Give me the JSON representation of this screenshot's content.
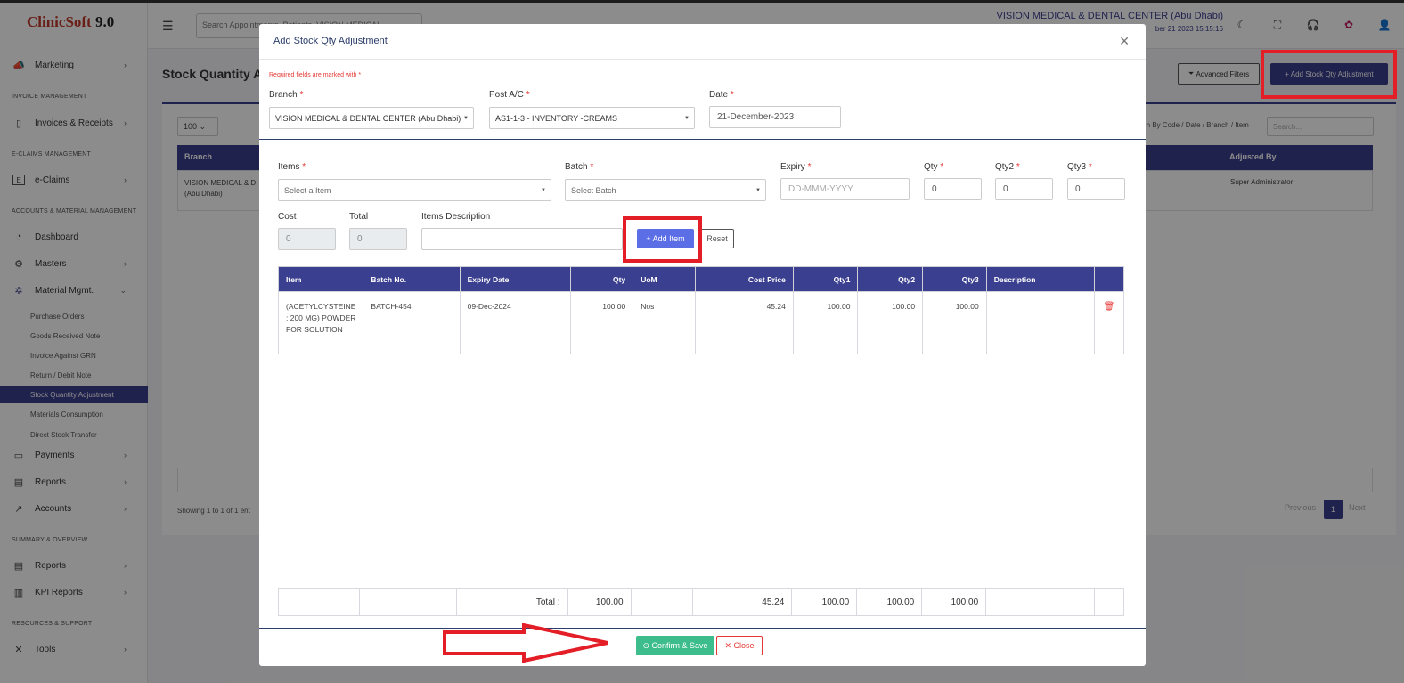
{
  "app": {
    "logo_main": "ClinicSoft",
    "logo_version": " 9.0"
  },
  "topbar": {
    "search_placeholder": "Search Appointments, Patients, VISION MEDICAL",
    "branch_name": "VISION MEDICAL & DENTAL CENTER (Abu Dhabi)",
    "datetime": "ber 21 2023 15:15:16"
  },
  "sidebar": {
    "marketing": "Marketing",
    "sec_invoice": "INVOICE MANAGEMENT",
    "invoices": "Invoices & Receipts",
    "sec_eclaims": "E-CLAIMS MANAGEMENT",
    "eclaims": "e-Claims",
    "sec_accounts": "ACCOUNTS & MATERIAL MANAGEMENT",
    "dashboard": "Dashboard",
    "masters": "Masters",
    "material": "Material Mgmt.",
    "sub": [
      "Purchase Orders",
      "Goods Received Note",
      "Invoice Against GRN",
      "Return / Debit Note"
    ],
    "active": "Stock Quantity Adjustment",
    "sub2": [
      "Materials Consumption",
      "Direct Stock Transfer"
    ],
    "payments": "Payments",
    "reports": "Reports",
    "accounts": "Accounts",
    "sec_summary": "SUMMARY & OVERVIEW",
    "reports2": "Reports",
    "kpi": "KPI Reports",
    "sec_resources": "RESOURCES & SUPPORT",
    "tools": "Tools"
  },
  "page": {
    "title": "Stock Quantity Ac",
    "advanced_filters": "Advanced Filters",
    "add_button": "+ Add Stock Qty Adjustment",
    "page_size": "100",
    "search_hint": "rch By Code / Date / Branch / Item",
    "search_placeholder": "Search...",
    "col_branch": "Branch",
    "col_adjusted_by": "Adjusted By",
    "row_branch": "VISION MEDICAL & D (Abu Dhabi)",
    "row_adjusted_by": "Super Administrator",
    "showing": "Showing 1 to 1 of 1 ent",
    "pager_prev": "Previous",
    "pager_page": "1",
    "pager_next": "Next"
  },
  "modal": {
    "title": "Add Stock Qty Adjustment",
    "required_note": "Required fields are marked with *",
    "branch_label": "Branch",
    "branch_value": "VISION MEDICAL & DENTAL CENTER (Abu Dhabi)",
    "post_ac_label": "Post A/C",
    "post_ac_value": "AS1-1-3 - INVENTORY -CREAMS",
    "date_label": "Date",
    "date_value": "21-December-2023",
    "items_label": "Items",
    "items_placeholder": "Select a Item",
    "batch_label": "Batch",
    "batch_placeholder": "Select Batch",
    "expiry_label": "Expiry",
    "expiry_placeholder": "DD-MMM-YYYY",
    "qty_label": "Qty",
    "qty_value": "0",
    "qty2_label": "Qty2",
    "qty2_value": "0",
    "qty3_label": "Qty3",
    "qty3_value": "0",
    "cost_label": "Cost",
    "cost_value": "0",
    "total_label": "Total",
    "total_value": "0",
    "desc_label": "Items Description",
    "add_item": "+ Add Item",
    "reset": "Reset",
    "star": "*"
  },
  "grid": {
    "headers": [
      "Item",
      "Batch No.",
      "Expiry Date",
      "Qty",
      "UoM",
      "Cost Price",
      "Qty1",
      "Qty2",
      "Qty3",
      "Description",
      ""
    ],
    "row": {
      "item": "(ACETYLCYSTEINE : 200 MG) POWDER FOR SOLUTION",
      "batch": "BATCH-454",
      "expiry": "09-Dec-2024",
      "qty": "100.00",
      "uom": "Nos",
      "cost": "45.24",
      "qty1": "100.00",
      "qty2": "100.00",
      "qty3": "100.00",
      "description": ""
    },
    "totals": {
      "label": "Total :",
      "qty": "100.00",
      "cost": "45.24",
      "qty1": "100.00",
      "qty2": "100.00",
      "qty3": "100.00"
    }
  },
  "footer": {
    "confirm": "Confirm & Save",
    "close": "Close"
  },
  "colors": {
    "primary": "#3b3f8f",
    "add_item": "#5b6ee6",
    "confirm": "#3dbd8b",
    "danger": "#e53935",
    "annotation": "#e41e26"
  }
}
